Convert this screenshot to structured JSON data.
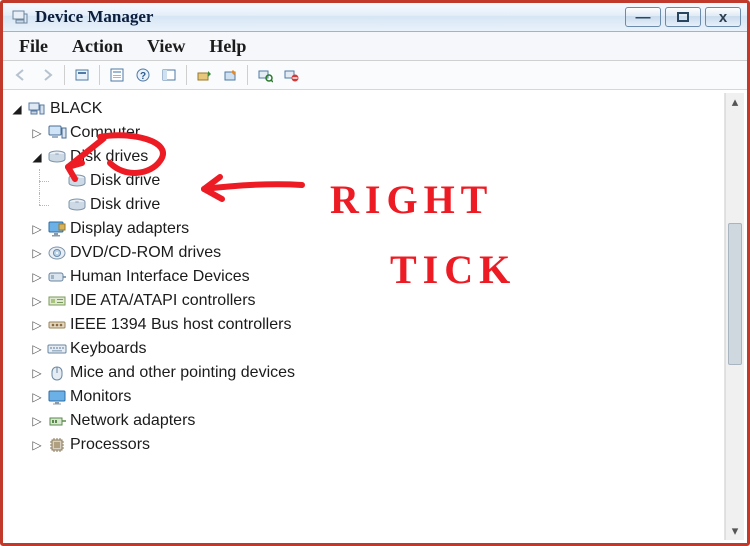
{
  "window": {
    "title": "Device Manager"
  },
  "menu": {
    "file": "File",
    "action": "Action",
    "view": "View",
    "help": "Help"
  },
  "toolbar": {
    "back": "back",
    "forward": "forward",
    "show_hidden": "show-hidden",
    "properties": "properties",
    "help": "help",
    "console": "console-tree",
    "update": "update-driver",
    "uninstall": "uninstall",
    "scan": "scan-hardware",
    "disable": "disable"
  },
  "tree": {
    "root": "BLACK",
    "nodes": [
      {
        "label": "Computer",
        "icon": "computer-icon",
        "expanded": false
      },
      {
        "label": "Disk drives",
        "icon": "disk-icon",
        "expanded": true,
        "children": [
          {
            "label": "Disk drive",
            "icon": "disk-icon"
          },
          {
            "label": "Disk drive",
            "icon": "disk-icon"
          }
        ]
      },
      {
        "label": "Display adapters",
        "icon": "display-icon",
        "expanded": false
      },
      {
        "label": "DVD/CD-ROM drives",
        "icon": "optical-icon",
        "expanded": false
      },
      {
        "label": "Human Interface Devices",
        "icon": "hid-icon",
        "expanded": false
      },
      {
        "label": "IDE ATA/ATAPI controllers",
        "icon": "ide-icon",
        "expanded": false
      },
      {
        "label": "IEEE 1394 Bus host controllers",
        "icon": "firewire-icon",
        "expanded": false
      },
      {
        "label": "Keyboards",
        "icon": "keyboard-icon",
        "expanded": false
      },
      {
        "label": "Mice and other pointing devices",
        "icon": "mouse-icon",
        "expanded": false
      },
      {
        "label": "Monitors",
        "icon": "monitor-icon",
        "expanded": false
      },
      {
        "label": "Network adapters",
        "icon": "network-icon",
        "expanded": false
      },
      {
        "label": "Processors",
        "icon": "cpu-icon",
        "expanded": false
      }
    ]
  },
  "annotation": {
    "line1": "RIGHT",
    "line2": "TICK",
    "color": "#ed1c24"
  }
}
